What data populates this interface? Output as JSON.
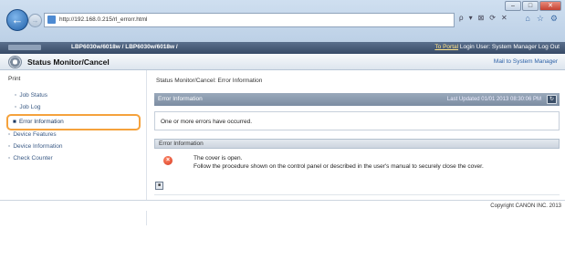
{
  "browser": {
    "url": "http://192.168.0.215/rl_errorr.html",
    "right_icons": [
      "ρ",
      "▾",
      "⊠",
      "⟳",
      "✕"
    ],
    "tab_icons": [
      "⌂",
      "☆",
      "⚙"
    ],
    "window_controls": [
      "–",
      "□",
      "✕"
    ]
  },
  "header": {
    "model": "LBP6030w/6018w / LBP6030w/6018w /",
    "portal_link": "To Portal",
    "login_text": "Login User: System Manager Log Out",
    "page_title": "Status Monitor/Cancel",
    "mail_link": "Mail to System Manager"
  },
  "sidebar": {
    "heading": "Print",
    "items": [
      {
        "label": "Job Status"
      },
      {
        "label": "Job Log"
      },
      {
        "label": "Error Information"
      },
      {
        "label": "Device Features"
      },
      {
        "label": "Device Information"
      },
      {
        "label": "Check Counter"
      }
    ]
  },
  "main": {
    "breadcrumb": "Status Monitor/Cancel: Error Information",
    "section1_title": "Error Information",
    "last_updated": "Last Updated 01/01 2013 08:30:06 PM",
    "message": "One or more errors have occurred.",
    "section2_title": "Error Information",
    "error_line1": "The cover is open.",
    "error_line2": "Follow the procedure shown on the control panel or described in the user's manual to securely close the cover."
  },
  "footer": {
    "copyright": "Copyright CANON INC. 2013"
  },
  "colors": {
    "highlight": "#f5a23c",
    "header_dark": "#374a66",
    "section_bar": "#7c8da2",
    "error_red": "#d5361e"
  }
}
